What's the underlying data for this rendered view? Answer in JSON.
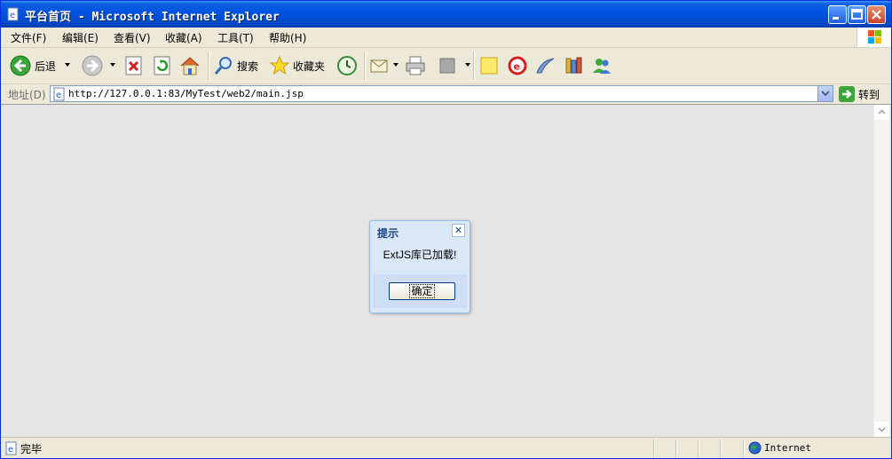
{
  "window": {
    "title": "平台首页 - Microsoft Internet Explorer"
  },
  "menu": [
    {
      "label": "文件(F)"
    },
    {
      "label": "编辑(E)"
    },
    {
      "label": "查看(V)"
    },
    {
      "label": "收藏(A)"
    },
    {
      "label": "工具(T)"
    },
    {
      "label": "帮助(H)"
    }
  ],
  "toolbar": {
    "back_label": "后退",
    "search_label": "搜索",
    "favorites_label": "收藏夹"
  },
  "address": {
    "label": "地址(D)",
    "url": "http://127.0.0.1:83/MyTest/web2/main.jsp",
    "go_label": "转到"
  },
  "dialog": {
    "title": "提示",
    "message": "ExtJS库已加载!",
    "ok_label": "确定",
    "close_glyph": "✕"
  },
  "status": {
    "text": "完毕",
    "zone": "Internet"
  },
  "colors": {
    "titlebar": "#0054e3",
    "dialog_title": "#15428b",
    "content_bg": "#e5e5e5"
  }
}
